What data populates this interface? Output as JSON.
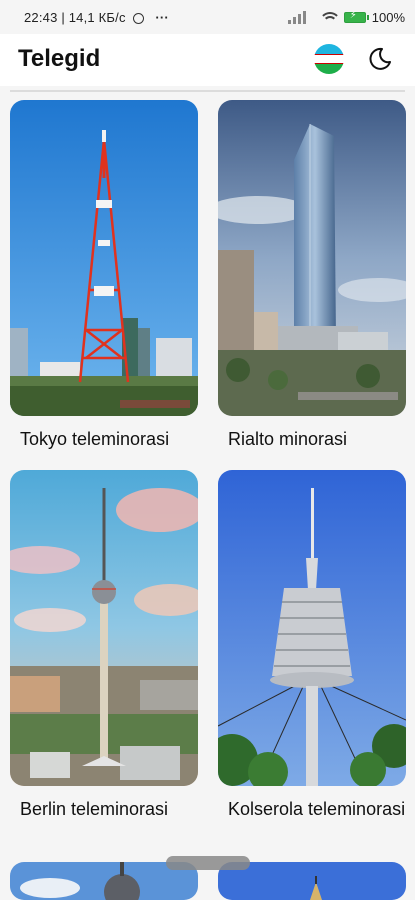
{
  "status_bar": {
    "time": "22:43",
    "network_speed": "14,1 КБ/с",
    "more": "···",
    "battery": "100%"
  },
  "header": {
    "title": "Telegid"
  },
  "towers": [
    {
      "name": "Tokyo teleminorasi"
    },
    {
      "name": "Rialto minorasi"
    },
    {
      "name": "Berlin teleminorasi"
    },
    {
      "name": "Kolserola teleminorasi"
    }
  ],
  "colors": {
    "accent_sky": "#2f8fe0",
    "tokyo_tower": "#e0321e",
    "flag_blue": "#1eb5e0",
    "flag_green": "#1eae4a"
  }
}
